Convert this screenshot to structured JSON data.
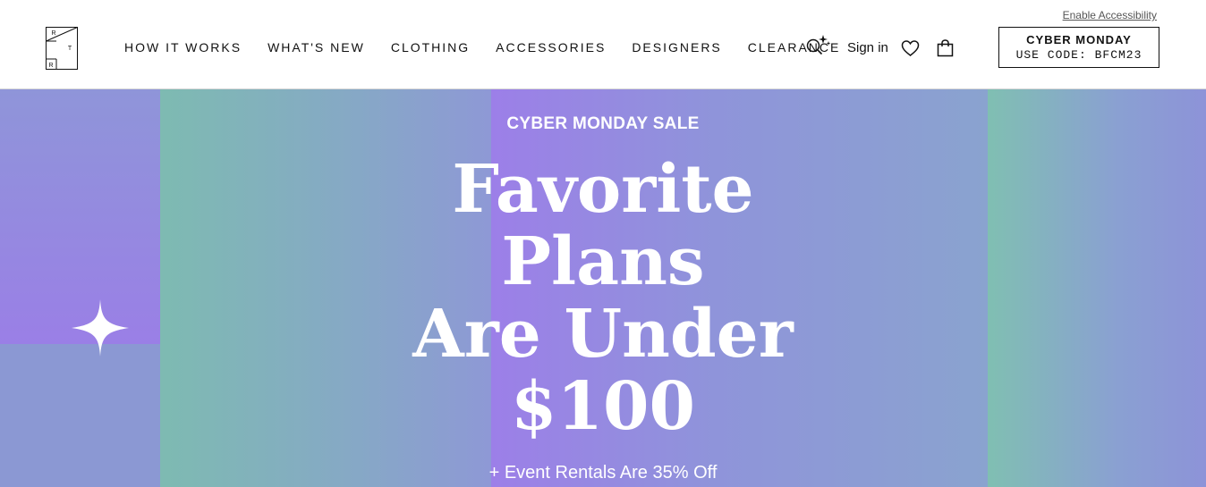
{
  "header": {
    "accessibility_link": "Enable Accessibility",
    "logo_letters": [
      "R",
      "T",
      "R"
    ],
    "nav": [
      "HOW IT WORKS",
      "WHAT'S NEW",
      "CLOTHING",
      "ACCESSORIES",
      "DESIGNERS",
      "CLEARANCE"
    ],
    "signin": "Sign in",
    "icons": [
      "search-sparkle-icon",
      "heart-icon",
      "shopping-bag-icon"
    ],
    "promo": {
      "line1": "CYBER MONDAY",
      "line2": "USE CODE: BFCM23"
    }
  },
  "hero": {
    "eyebrow": "CYBER MONDAY SALE",
    "headline_lines": [
      "Favorite",
      "Plans",
      "Are Under",
      "$100"
    ],
    "subline": "+ Event Rentals Are 35% Off",
    "colors": {
      "purple": "#9a7fe6",
      "teal": "#7dbcb0",
      "blue": "#8c97d2"
    }
  }
}
